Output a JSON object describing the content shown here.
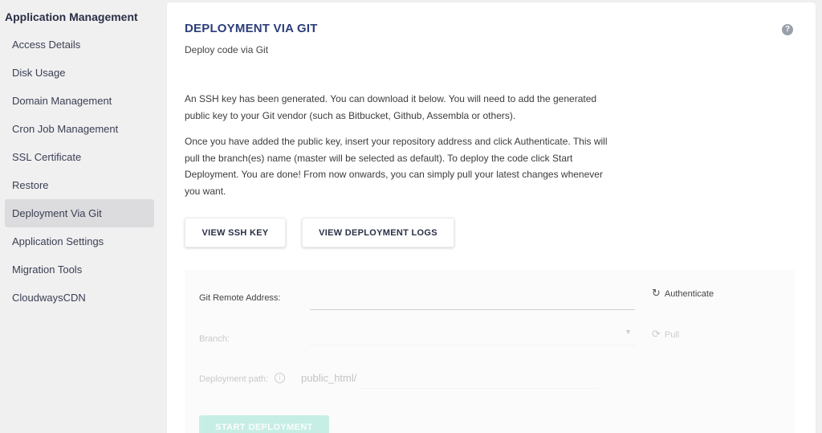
{
  "sidebar": {
    "title": "Application Management",
    "items": [
      {
        "label": "Access Details"
      },
      {
        "label": "Disk Usage"
      },
      {
        "label": "Domain Management"
      },
      {
        "label": "Cron Job Management"
      },
      {
        "label": "SSL Certificate"
      },
      {
        "label": "Restore"
      },
      {
        "label": "Deployment Via Git"
      },
      {
        "label": "Application Settings"
      },
      {
        "label": "Migration Tools"
      },
      {
        "label": "CloudwaysCDN"
      }
    ],
    "active_index": 6
  },
  "main": {
    "title": "DEPLOYMENT VIA GIT",
    "subtitle": "Deploy code via Git",
    "help_icon": "?",
    "paragraph1": "An SSH key has been generated. You can download it below. You will need to add the generated public key to your Git vendor (such as Bitbucket, Github, Assembla or others).",
    "paragraph2": "Once you have added the public key, insert your repository address and click Authenticate. This will pull the branch(es) name (master will be selected as default). To deploy the code click Start Deployment. You are done! From now onwards, you can simply pull your latest changes whenever you want.",
    "buttons": {
      "view_ssh_key": "VIEW SSH KEY",
      "view_deployment_logs": "VIEW DEPLOYMENT LOGS"
    }
  },
  "form": {
    "git_remote_label": "Git Remote Address:",
    "git_remote_value": "",
    "authenticate_label": "Authenticate",
    "branch_label": "Branch:",
    "branch_value": "",
    "pull_label": "Pull",
    "deployment_path_label": "Deployment path:",
    "deployment_path_prefix": "public_html/",
    "deployment_path_value": "",
    "start_deployment_label": "START DEPLOYMENT"
  },
  "colors": {
    "title": "#2c3e7a",
    "start_button": "#3fcfae",
    "active_sidebar": "#dcdcde"
  }
}
